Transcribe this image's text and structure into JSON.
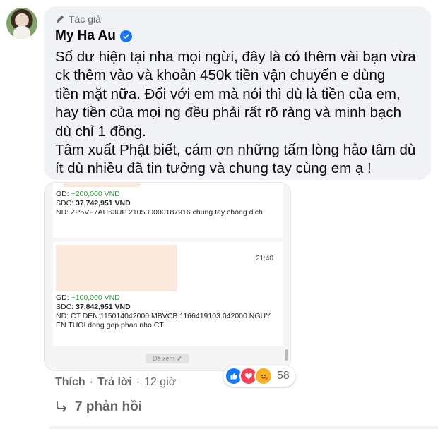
{
  "comment": {
    "author_badge": "Tác giả",
    "author_name": "My Ha Au",
    "text_lines": [
      "Số dư hiện tại nha mọi ngừi, đây là có thêm vài bạn vừa",
      "ck thêm vào và khoản 450k tiền vận chuyển e dùng",
      "tiền mặt nữa. Đối với em mà nói thì dù là tiền của em,",
      "hay tiền của mọi ng đều phải rất rõ ràng và minh bạch",
      "dù chỉ 1 đồng.",
      "Tâm xuất Phật biết, cám ơn những tấm lòng hảo tâm dù",
      "ít dù nhiều đã tin tưởng và chung tay cùng em ạ !"
    ]
  },
  "attachment": {
    "message1": {
      "gd_label": "GD: ",
      "gd_value": "+200,000 VND",
      "sdc_label": "SDC: ",
      "sdc_value": "37,742,951 VND",
      "nd": "ND: ZP5VF7AU63UP 210530000187916 chung tay chong dich"
    },
    "message2": {
      "time": "21:40",
      "gd_label": "GD: ",
      "gd_value": "+100,000 VND",
      "sdc_label": "SDC: ",
      "sdc_value": "37,842,951 VND",
      "nd_line1": "ND: CT DEN:115014042000 MBVCB.1166419103.042000.NGUY",
      "nd_line2": "EN TUOI dong gop phan nho.CT ~"
    },
    "seen_label": "Đã xem"
  },
  "reactions": {
    "count": "58",
    "types": [
      "like",
      "love",
      "care"
    ]
  },
  "actions": {
    "like": "Thích",
    "separator": "·",
    "reply": "Trả lời",
    "time": "12 giờ"
  },
  "replies": {
    "label": "7 phản hồi"
  },
  "colors": {
    "bubble": "#f0f2f5",
    "muted": "#65676b",
    "blue": "#1877f2",
    "green": "#2e9b3c"
  }
}
